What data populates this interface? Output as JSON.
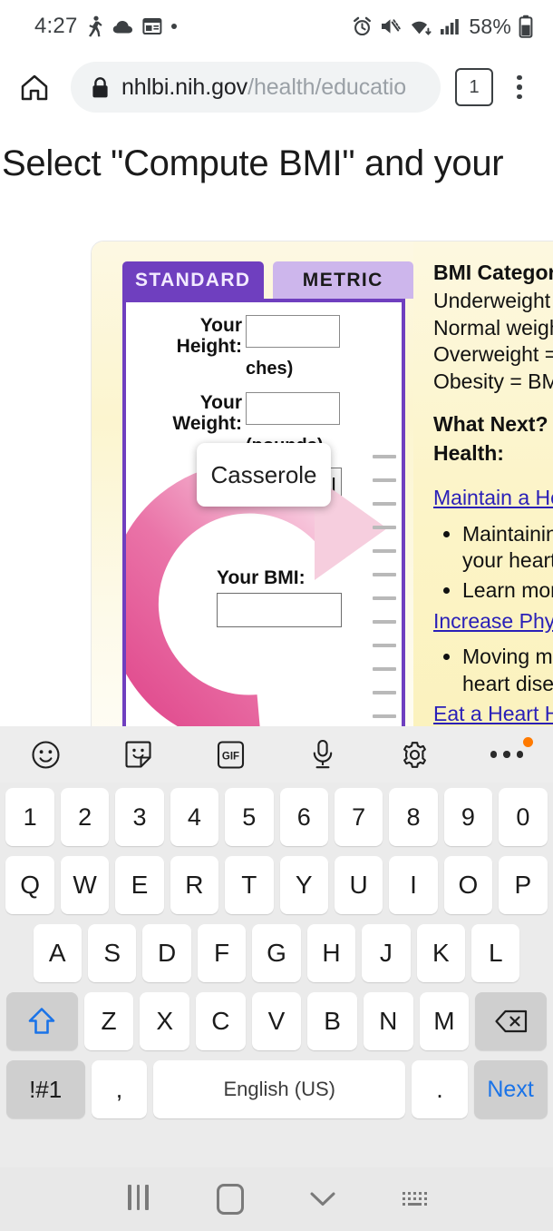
{
  "status_bar": {
    "time": "4:27",
    "battery_percent": "58%",
    "left_icons": [
      "walking-person-icon",
      "cloud-icon",
      "news-calendar-icon",
      "dot-icon"
    ],
    "right_icons": [
      "alarm-icon",
      "vibrate-mute-icon",
      "wifi-icon",
      "cellular-signal-icon",
      "battery-icon"
    ]
  },
  "browser": {
    "home_icon": "home-icon",
    "lock_icon": "lock-icon",
    "url_secure": "nhlbi.nih.gov",
    "url_path": "/health/educatio",
    "tab_count": "1",
    "menu_icon": "overflow-menu-icon"
  },
  "page": {
    "heading": "Select \"Compute BMI\" and your",
    "calculator": {
      "tabs": [
        {
          "label": "STANDARD",
          "selected": true
        },
        {
          "label": "METRIC",
          "selected": false
        }
      ],
      "height_label": "Your\nHeight:",
      "height_label_line1": "Your",
      "height_label_line2": "Height:",
      "height_value": "",
      "height_unit": "ches)",
      "weight_label_line1": "Your",
      "weight_label_line2": "Weight:",
      "weight_value": "",
      "weight_unit": "(pounds)",
      "compute_button": "Compute BMI",
      "result_label": "Your BMI:",
      "result_value": "",
      "arrow_icon": "circular-pink-arrow-icon",
      "ruler_icon": "ruler-ticks-icon"
    },
    "info_panel": {
      "categories_title": "BMI Categorie",
      "categories": [
        "Underweight =",
        "Normal weigh",
        "Overweight =",
        "Obesity = BMI"
      ],
      "next_title_line1": "What Next? Ta",
      "next_title_line2": "Health:",
      "link_1": "Maintain a He",
      "bullets_1": [
        "Maintainin",
        "your heart"
      ],
      "bullet_1b": "Learn more",
      "link_2": "Increase Phys",
      "bullets_2": [
        "Moving mo",
        "heart disea"
      ],
      "link_3": "Eat a Heart H"
    },
    "autocomplete_popup": {
      "suggestion": "Casserole"
    }
  },
  "keyboard": {
    "toolbar": [
      {
        "name": "emoji-icon"
      },
      {
        "name": "sticker-icon"
      },
      {
        "name": "gif-icon",
        "label": "GIF"
      },
      {
        "name": "microphone-icon"
      },
      {
        "name": "settings-gear-icon"
      },
      {
        "name": "more-options-icon",
        "badge": true
      }
    ],
    "row_numbers": [
      "1",
      "2",
      "3",
      "4",
      "5",
      "6",
      "7",
      "8",
      "9",
      "0"
    ],
    "row_top": [
      "Q",
      "W",
      "E",
      "R",
      "T",
      "Y",
      "U",
      "I",
      "O",
      "P"
    ],
    "row_home": [
      "A",
      "S",
      "D",
      "F",
      "G",
      "H",
      "J",
      "K",
      "L"
    ],
    "row_bottom": [
      "Z",
      "X",
      "C",
      "V",
      "B",
      "N",
      "M"
    ],
    "shift_icon": "shift-up-arrow-icon",
    "backspace_icon": "backspace-delete-icon",
    "symbols_key": "!#1",
    "comma_key": ",",
    "space_key": "English (US)",
    "period_key": ".",
    "next_key": "Next"
  },
  "nav_bar": {
    "recents_icon": "recents-icon",
    "home_icon": "home-square-icon",
    "hide_keyboard_icon": "chevron-down-icon",
    "keyboard_switch_icon": "keyboard-icon"
  },
  "colors": {
    "accent_purple": "#6f3fbf",
    "tab_inactive": "#cdb6ec",
    "panel_yellow": "#fcf4c8",
    "arrow_pink": "#e05b96",
    "link_blue": "#2a20b8",
    "next_blue": "#1a73e8",
    "badge_orange": "#ff7a00"
  }
}
